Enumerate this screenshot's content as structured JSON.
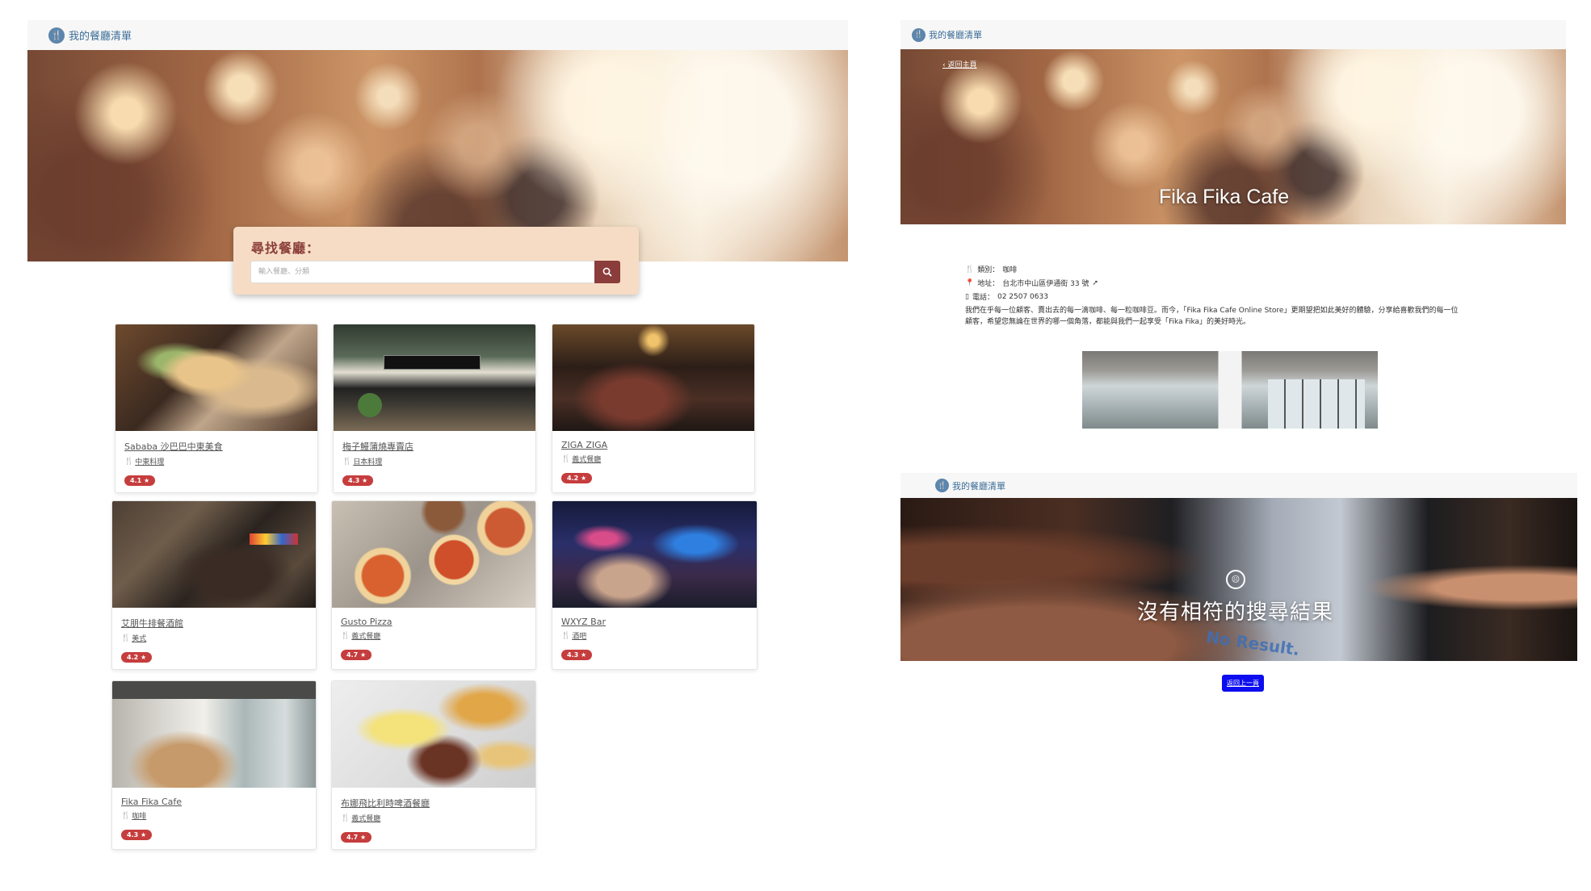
{
  "brand": {
    "name": "我的餐廳清單"
  },
  "search": {
    "title": "尋找餐廳：",
    "placeholder": "輸入餐廳、分類"
  },
  "restaurants": [
    {
      "name": "Sababa 沙巴巴中東美食",
      "category": "中東料理",
      "rating": "4.1"
    },
    {
      "name": "梅子鰻蒲燒專賣店",
      "category": "日本料理",
      "rating": "4.3"
    },
    {
      "name": "ZIGA ZIGA",
      "category": "義式餐廳",
      "rating": "4.2"
    },
    {
      "name": "艾朋牛排餐酒館",
      "category": "美式",
      "rating": "4.2"
    },
    {
      "name": "Gusto Pizza",
      "category": "義式餐廳",
      "rating": "4.7"
    },
    {
      "name": "WXYZ Bar",
      "category": "酒吧",
      "rating": "4.3"
    },
    {
      "name": "Fika Fika Cafe",
      "category": "咖啡",
      "rating": "4.3"
    },
    {
      "name": "布娜飛比利時啤酒餐廳",
      "category": "義式餐廳",
      "rating": "4.7"
    }
  ],
  "detail": {
    "back_label": "返回主頁",
    "name": "Fika Fika Cafe",
    "category_label": "類別：",
    "category": "咖啡",
    "address_label": "地址：",
    "address": "台北市中山區伊通街 33 號",
    "phone_label": "電話：",
    "phone": "02 2507 0633",
    "description_1": "我們在乎每一位顧客、賣出去的每一滴咖啡、每一粒咖啡豆。而今，「Fika Fika Cafe Online Store」更期望把如此美好的體驗，分享給喜歡我們的每一位",
    "description_2": "顧客，希望您無論在世界的哪一個角落，都能與我們一起享受「Fika Fika」的美好時光。"
  },
  "noresult": {
    "title": "沒有相符的搜尋結果",
    "phone_text": "No Result.",
    "back_button": "返回上一頁"
  },
  "colors": {
    "brand": "#3b6c97",
    "accent": "#8a3d3a",
    "badge": "#c63d3d",
    "button": "#0d0df0"
  }
}
